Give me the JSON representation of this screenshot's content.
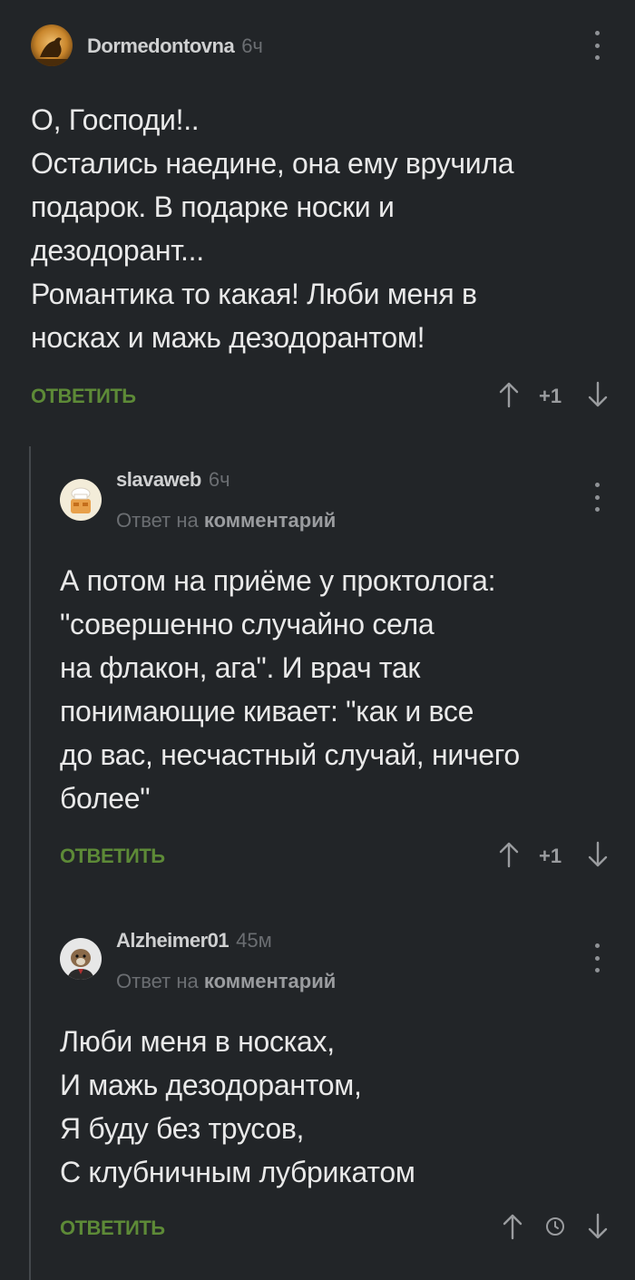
{
  "comments": [
    {
      "author": "Dormedontovna",
      "time": "6ч",
      "text": "О, Господи!..\nОстались наедине, она ему вручила\nподарок. В подарке носки и\nдезодорант...\nРомантика то какая! Люби меня в\nносках и мажь дезодорантом!",
      "reply_label": "ОТВЕТИТЬ",
      "score": "+1",
      "avatar_icon": "bird-avatar-icon"
    },
    {
      "author": "slavaweb",
      "time": "6ч",
      "reply_prefix": "Ответ на",
      "reply_target": "комментарий",
      "text": "А потом на приёме у проктолога:\n\"совершенно случайно села\nна флакон, ага\". И врач так\nпонимающие кивает: \"как и все\nдо вас, несчастный случай, ничего\nболее\"",
      "reply_label": "ОТВЕТИТЬ",
      "score": "+1",
      "avatar_icon": "chef-avatar-icon"
    },
    {
      "author": "Alzheimer01",
      "time": "45м",
      "reply_prefix": "Ответ на",
      "reply_target": "комментарий",
      "text": "Люби меня в носках,\nИ мажь дезодорантом,\nЯ буду без трусов,\nС клубничным лубрикатом",
      "reply_label": "ОТВЕТИТЬ",
      "score_icon": "clock-icon",
      "avatar_icon": "dog-avatar-icon"
    }
  ],
  "colors": {
    "background": "#222528",
    "reply_green": "#5d8a37",
    "muted": "#6b6e72"
  }
}
